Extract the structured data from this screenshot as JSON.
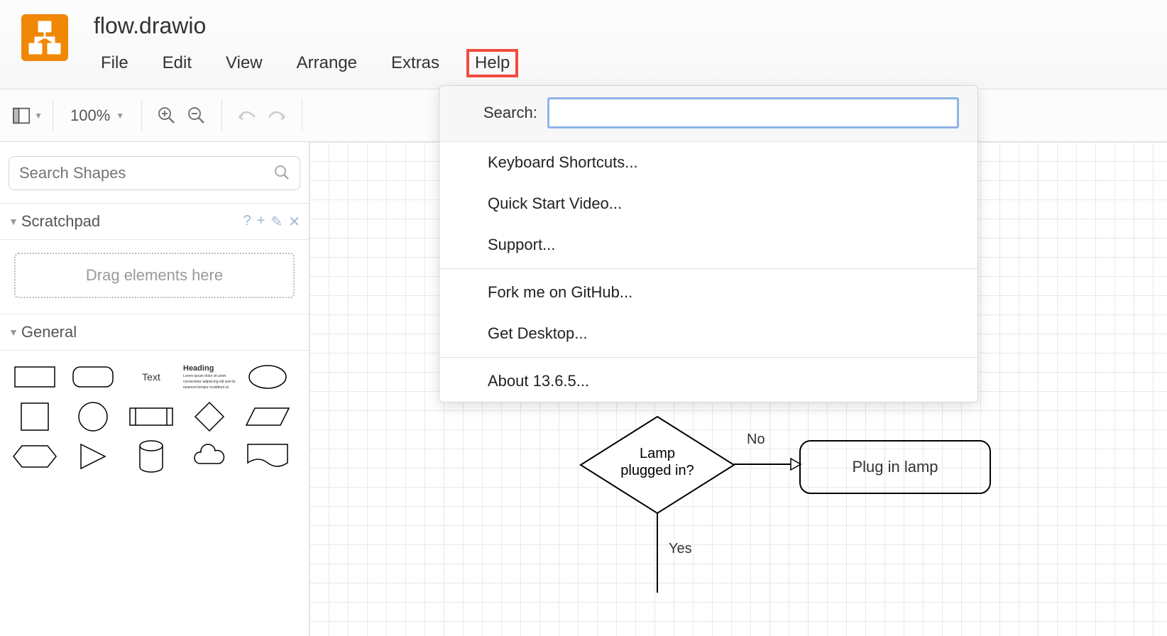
{
  "header": {
    "filename": "flow.drawio",
    "menu": [
      "File",
      "Edit",
      "View",
      "Arrange",
      "Extras",
      "Help"
    ],
    "active_menu": "Help"
  },
  "toolbar": {
    "zoom": "100%"
  },
  "sidebar": {
    "search_placeholder": "Search Shapes",
    "scratchpad_title": "Scratchpad",
    "drop_hint": "Drag elements here",
    "general_title": "General",
    "shape_text": "Text",
    "shape_heading": "Heading"
  },
  "help_menu": {
    "search_label": "Search:",
    "items_a": [
      "Keyboard Shortcuts...",
      "Quick Start Video...",
      "Support..."
    ],
    "items_b": [
      "Fork me on GitHub...",
      "Get Desktop..."
    ],
    "items_c": [
      "About 13.6.5..."
    ]
  },
  "canvas": {
    "decision_text_l1": "Lamp",
    "decision_text_l2": "plugged in?",
    "process_text": "Plug in lamp",
    "label_no": "No",
    "label_yes": "Yes"
  }
}
